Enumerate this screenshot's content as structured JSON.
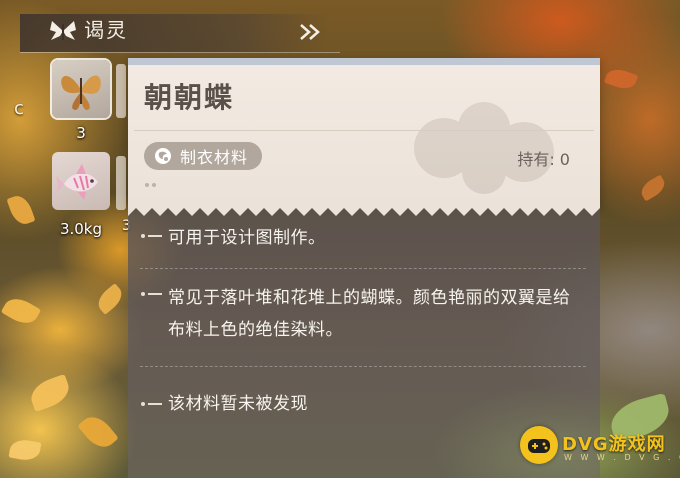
{
  "header": {
    "title": "谒灵",
    "logo_icon": "butterfly-emblem-icon",
    "forward_icon": "double-chevron-right-icon"
  },
  "items": [
    {
      "icon": "butterfly-icon",
      "count": "3",
      "selected": true
    },
    {
      "icon": "fish-icon",
      "count": "3.0kg",
      "selected": false
    }
  ],
  "edge_fragments": {
    "left_c": "c",
    "right_3": "3"
  },
  "detail": {
    "title": "朝朝蝶",
    "category": "制衣材料",
    "category_icon": "material-icon",
    "owned": "持有: 0",
    "descriptions": [
      "可用于设计图制作。",
      "常见于落叶堆和花堆上的蝴蝶。颜色艳丽的双翼是给布料上色的绝佳染料。",
      "该材料暂未被发现"
    ]
  },
  "watermark": {
    "logo_icon": "gamepad-icon",
    "text": "DVG游戏网",
    "subtext": "W W W . D V G . C N"
  },
  "colors": {
    "card_light": "#f3ebe3",
    "card_dark": "#5c5454",
    "pill": "#b1a79d",
    "title": "#5b514b",
    "watermark": "#f3c21d"
  }
}
